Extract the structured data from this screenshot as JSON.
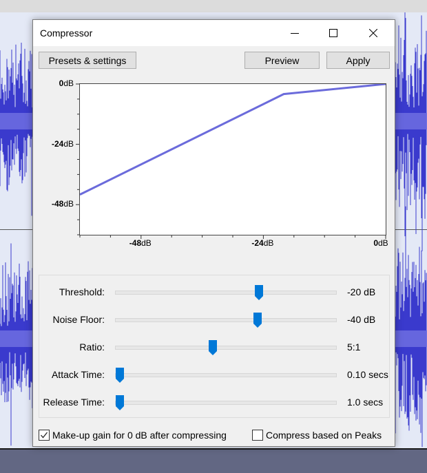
{
  "dialog": {
    "title": "Compressor",
    "window_buttons": {
      "minimize": "minimize-icon",
      "maximize": "maximize-icon",
      "close": "close-icon"
    },
    "toolbar": {
      "presets_label": "Presets & settings",
      "preview_label": "Preview",
      "apply_label": "Apply"
    }
  },
  "chart_data": {
    "type": "line",
    "title": "",
    "xlabel": "",
    "ylabel": "",
    "xlim": [
      -60,
      0
    ],
    "ylim": [
      -60,
      0
    ],
    "x_ticks": [
      "-48dB",
      "-24dB",
      "0dB"
    ],
    "x_tick_values": [
      -48,
      -24,
      0
    ],
    "y_ticks": [
      "0dB",
      "-24dB",
      "-48dB"
    ],
    "y_tick_values": [
      0,
      -24,
      -48
    ],
    "minor_tick_step": 6,
    "grid": false,
    "series": [
      {
        "name": "compression-curve",
        "color": "#6b6bdb",
        "x": [
          -60,
          -20,
          0
        ],
        "y": [
          -44,
          -4,
          0
        ]
      }
    ]
  },
  "sliders": [
    {
      "label": "Threshold:",
      "value": "-20 dB",
      "position": 0.66
    },
    {
      "label": "Noise Floor:",
      "value": "-40 dB",
      "position": 0.655
    },
    {
      "label": "Ratio:",
      "value": "5:1",
      "position": 0.44
    },
    {
      "label": "Attack Time:",
      "value": "0.10 secs",
      "position": 0.0
    },
    {
      "label": "Release Time:",
      "value": "1.0 secs",
      "position": 0.0
    }
  ],
  "options": {
    "makeup_gain": {
      "label": "Make-up gain for 0 dB after compressing",
      "checked": true
    },
    "compress_peaks": {
      "label": "Compress based on Peaks",
      "checked": false
    }
  },
  "colors": {
    "accent": "#0078d7",
    "curve": "#6b6bdb",
    "waveform": "#3a3acd",
    "waveform_rms": "#6e6ee0"
  }
}
